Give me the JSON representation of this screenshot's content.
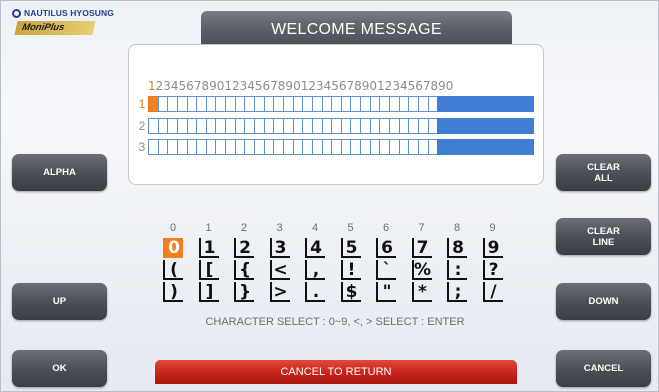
{
  "brand": {
    "company": "NAUTILUS HYOSUNG",
    "product": "MoniPlus"
  },
  "title": "WELCOME MESSAGE",
  "editor": {
    "ruler": "1234567890123456789012345678901234567890",
    "rows": [
      {
        "label": "1",
        "cursor_col": 1,
        "filled_from": 31
      },
      {
        "label": "2",
        "cursor_col": null,
        "filled_from": 31
      },
      {
        "label": "3",
        "cursor_col": null,
        "filled_from": 31
      }
    ],
    "columns": 40
  },
  "left_buttons": {
    "alpha": "ALPHA",
    "up": "UP",
    "ok": "OK"
  },
  "right_buttons": {
    "clear_all": "CLEAR\nALL",
    "clear_line": "CLEAR\nLINE",
    "down": "DOWN",
    "cancel": "CANCEL"
  },
  "char_select": {
    "columns": [
      "0",
      "1",
      "2",
      "3",
      "4",
      "5",
      "6",
      "7",
      "8",
      "9"
    ],
    "rows": [
      [
        "0",
        "1",
        "2",
        "3",
        "4",
        "5",
        "6",
        "7",
        "8",
        "9"
      ],
      [
        "(",
        "[",
        "{",
        "<",
        ",",
        "!",
        "`",
        "%",
        ":",
        "?"
      ],
      [
        ")",
        "]",
        "}",
        ">",
        ".",
        "$",
        "\"",
        "*",
        ";",
        "/"
      ]
    ],
    "selected": "0",
    "hint": "CHARACTER SELECT : 0~9, <, >  SELECT : ENTER"
  },
  "cancel_to_return": "CANCEL TO RETURN"
}
